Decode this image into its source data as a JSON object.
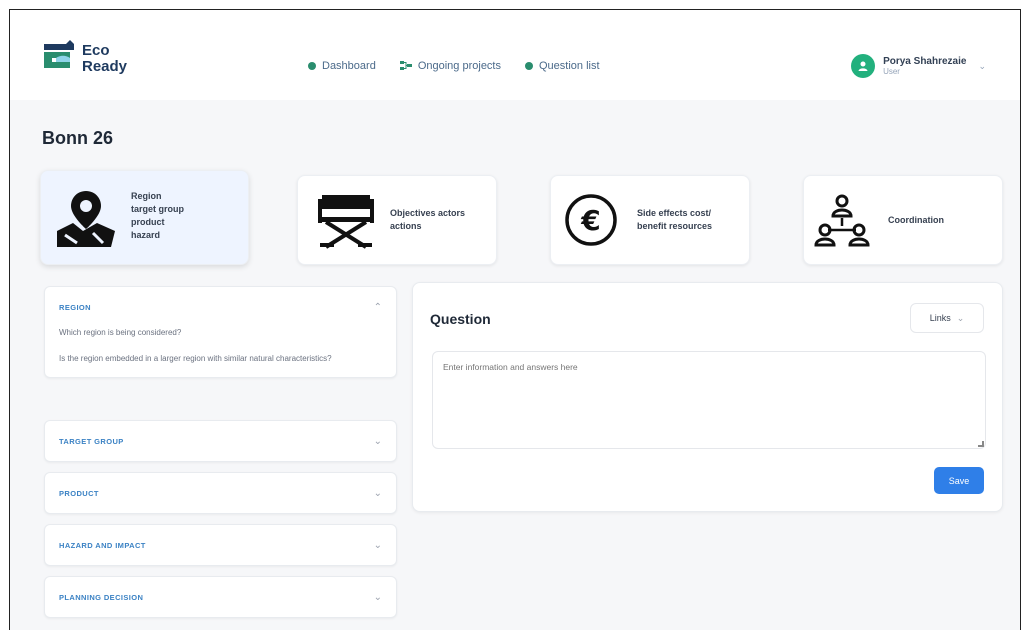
{
  "brand": {
    "name_line1": "Eco",
    "name_line2": "Ready",
    "colors": {
      "green": "#2a8d6e",
      "navy": "#1e3a5f",
      "blue": "#2f7fe8"
    }
  },
  "nav": [
    {
      "label": "Dashboard",
      "icon": "dashboard-dot-icon"
    },
    {
      "label": "Ongoing projects",
      "icon": "projects-icon"
    },
    {
      "label": "Question list",
      "icon": "question-list-dot-icon"
    }
  ],
  "user": {
    "name": "Porya Shahrezaie",
    "role": "User",
    "icon": "user-avatar-icon"
  },
  "page": {
    "title": "Bonn 26"
  },
  "categories": [
    {
      "label": "Region\ntarget group\nproduct\nhazard",
      "icon": "map-pin-icon",
      "active": true
    },
    {
      "label": "Objectives actors\nactions",
      "icon": "directors-chair-icon",
      "active": false
    },
    {
      "label": "Side effects cost/\nbenefit resources",
      "icon": "euro-icon",
      "active": false
    },
    {
      "label": "Coordination",
      "icon": "org-chart-icon",
      "active": false
    }
  ],
  "accordion": [
    {
      "title": "REGION",
      "expanded": true,
      "questions": [
        "Which region is being considered?",
        "Is the region embedded in a larger region with similar natural characteristics?"
      ]
    },
    {
      "title": "TARGET GROUP",
      "expanded": false
    },
    {
      "title": "PRODUCT",
      "expanded": false
    },
    {
      "title": "HAZARD AND IMPACT",
      "expanded": false
    },
    {
      "title": "PLANNING DECISION",
      "expanded": false
    }
  ],
  "question_panel": {
    "title": "Question",
    "links_label": "Links",
    "placeholder": "Enter information and answers here",
    "save_label": "Save"
  }
}
